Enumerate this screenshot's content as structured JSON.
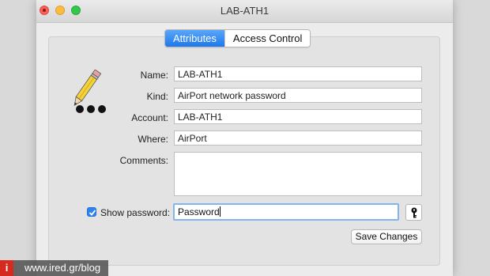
{
  "window": {
    "title": "LAB-ATH1"
  },
  "tabs": [
    {
      "label": "Attributes",
      "active": true
    },
    {
      "label": "Access Control",
      "active": false
    }
  ],
  "form": {
    "name_label": "Name:",
    "name_value": "LAB-ATH1",
    "kind_label": "Kind:",
    "kind_value": "AirPort network password",
    "account_label": "Account:",
    "account_value": "LAB-ATH1",
    "where_label": "Where:",
    "where_value": "AirPort",
    "comments_label": "Comments:",
    "comments_value": "",
    "show_password_label": "Show password:",
    "show_password_checked": true,
    "password_value": "Password",
    "save_label": "Save Changes"
  },
  "watermark": {
    "logo": "i",
    "text": "www.ired.gr/blog"
  },
  "icons": {
    "close": "close-icon",
    "minimize": "minimize-icon",
    "zoom": "zoom-icon",
    "keychain": "pencil-dots-icon",
    "key": "key-icon",
    "check": "checkmark-icon"
  },
  "colors": {
    "accent": "#1e79ea",
    "brand_red": "#d52b1e"
  }
}
